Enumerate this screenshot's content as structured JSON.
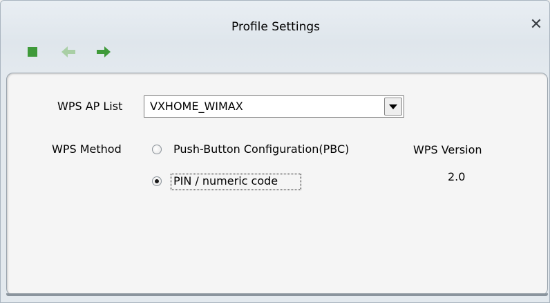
{
  "window": {
    "title": "Profile Settings",
    "close_icon": "close-icon"
  },
  "toolbar": {
    "items": [
      {
        "icon": "stop-icon",
        "color": "#3f9a3a"
      },
      {
        "icon": "back-arrow-icon",
        "color": "#a9cfa5"
      },
      {
        "icon": "forward-arrow-icon",
        "color": "#3f9a3a"
      }
    ]
  },
  "form": {
    "ap_list_label": "WPS AP List",
    "ap_list_value": "VXHOME_WIMAX",
    "method_label": "WPS Method",
    "method_options": [
      {
        "label": "Push-Button Configuration(PBC)",
        "selected": false
      },
      {
        "label": "PIN / numeric code",
        "selected": true
      }
    ],
    "version_label": "WPS Version",
    "version_value": "2.0"
  }
}
